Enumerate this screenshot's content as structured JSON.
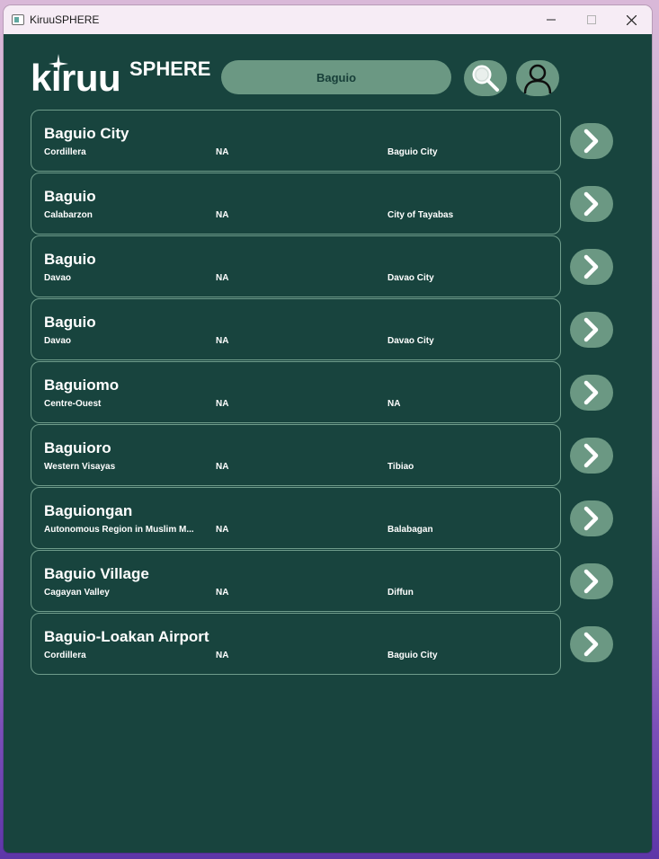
{
  "window": {
    "title": "KiruuSPHERE",
    "controls": {
      "minimize": "—",
      "maximize": "☐",
      "close": "✕"
    }
  },
  "header": {
    "logo_main": "kiruu",
    "logo_sup": "SPHERE",
    "search_value": "Baguio",
    "search_icon": "magnifier-icon",
    "profile_icon": "user-icon"
  },
  "colors": {
    "background": "#18443e",
    "accent": "#6b9883",
    "card_border": "#6f9c8b",
    "text": "#ffffff"
  },
  "results": [
    {
      "name": "Baguio City",
      "region": "Cordillera",
      "province": "NA",
      "city": "Baguio City"
    },
    {
      "name": "Baguio",
      "region": "Calabarzon",
      "province": "NA",
      "city": "City of Tayabas"
    },
    {
      "name": "Baguio",
      "region": "Davao",
      "province": "NA",
      "city": "Davao City"
    },
    {
      "name": "Baguio",
      "region": "Davao",
      "province": "NA",
      "city": "Davao City"
    },
    {
      "name": "Baguiomo",
      "region": "Centre-Ouest",
      "province": "NA",
      "city": "NA"
    },
    {
      "name": "Baguioro",
      "region": "Western Visayas",
      "province": "NA",
      "city": "Tibiao"
    },
    {
      "name": "Baguiongan",
      "region": "Autonomous Region in Muslim M...",
      "province": "NA",
      "city": "Balabagan"
    },
    {
      "name": "Baguio Village",
      "region": "Cagayan Valley",
      "province": "NA",
      "city": "Diffun"
    },
    {
      "name": "Baguio-Loakan Airport",
      "region": "Cordillera",
      "province": "NA",
      "city": "Baguio City"
    }
  ]
}
